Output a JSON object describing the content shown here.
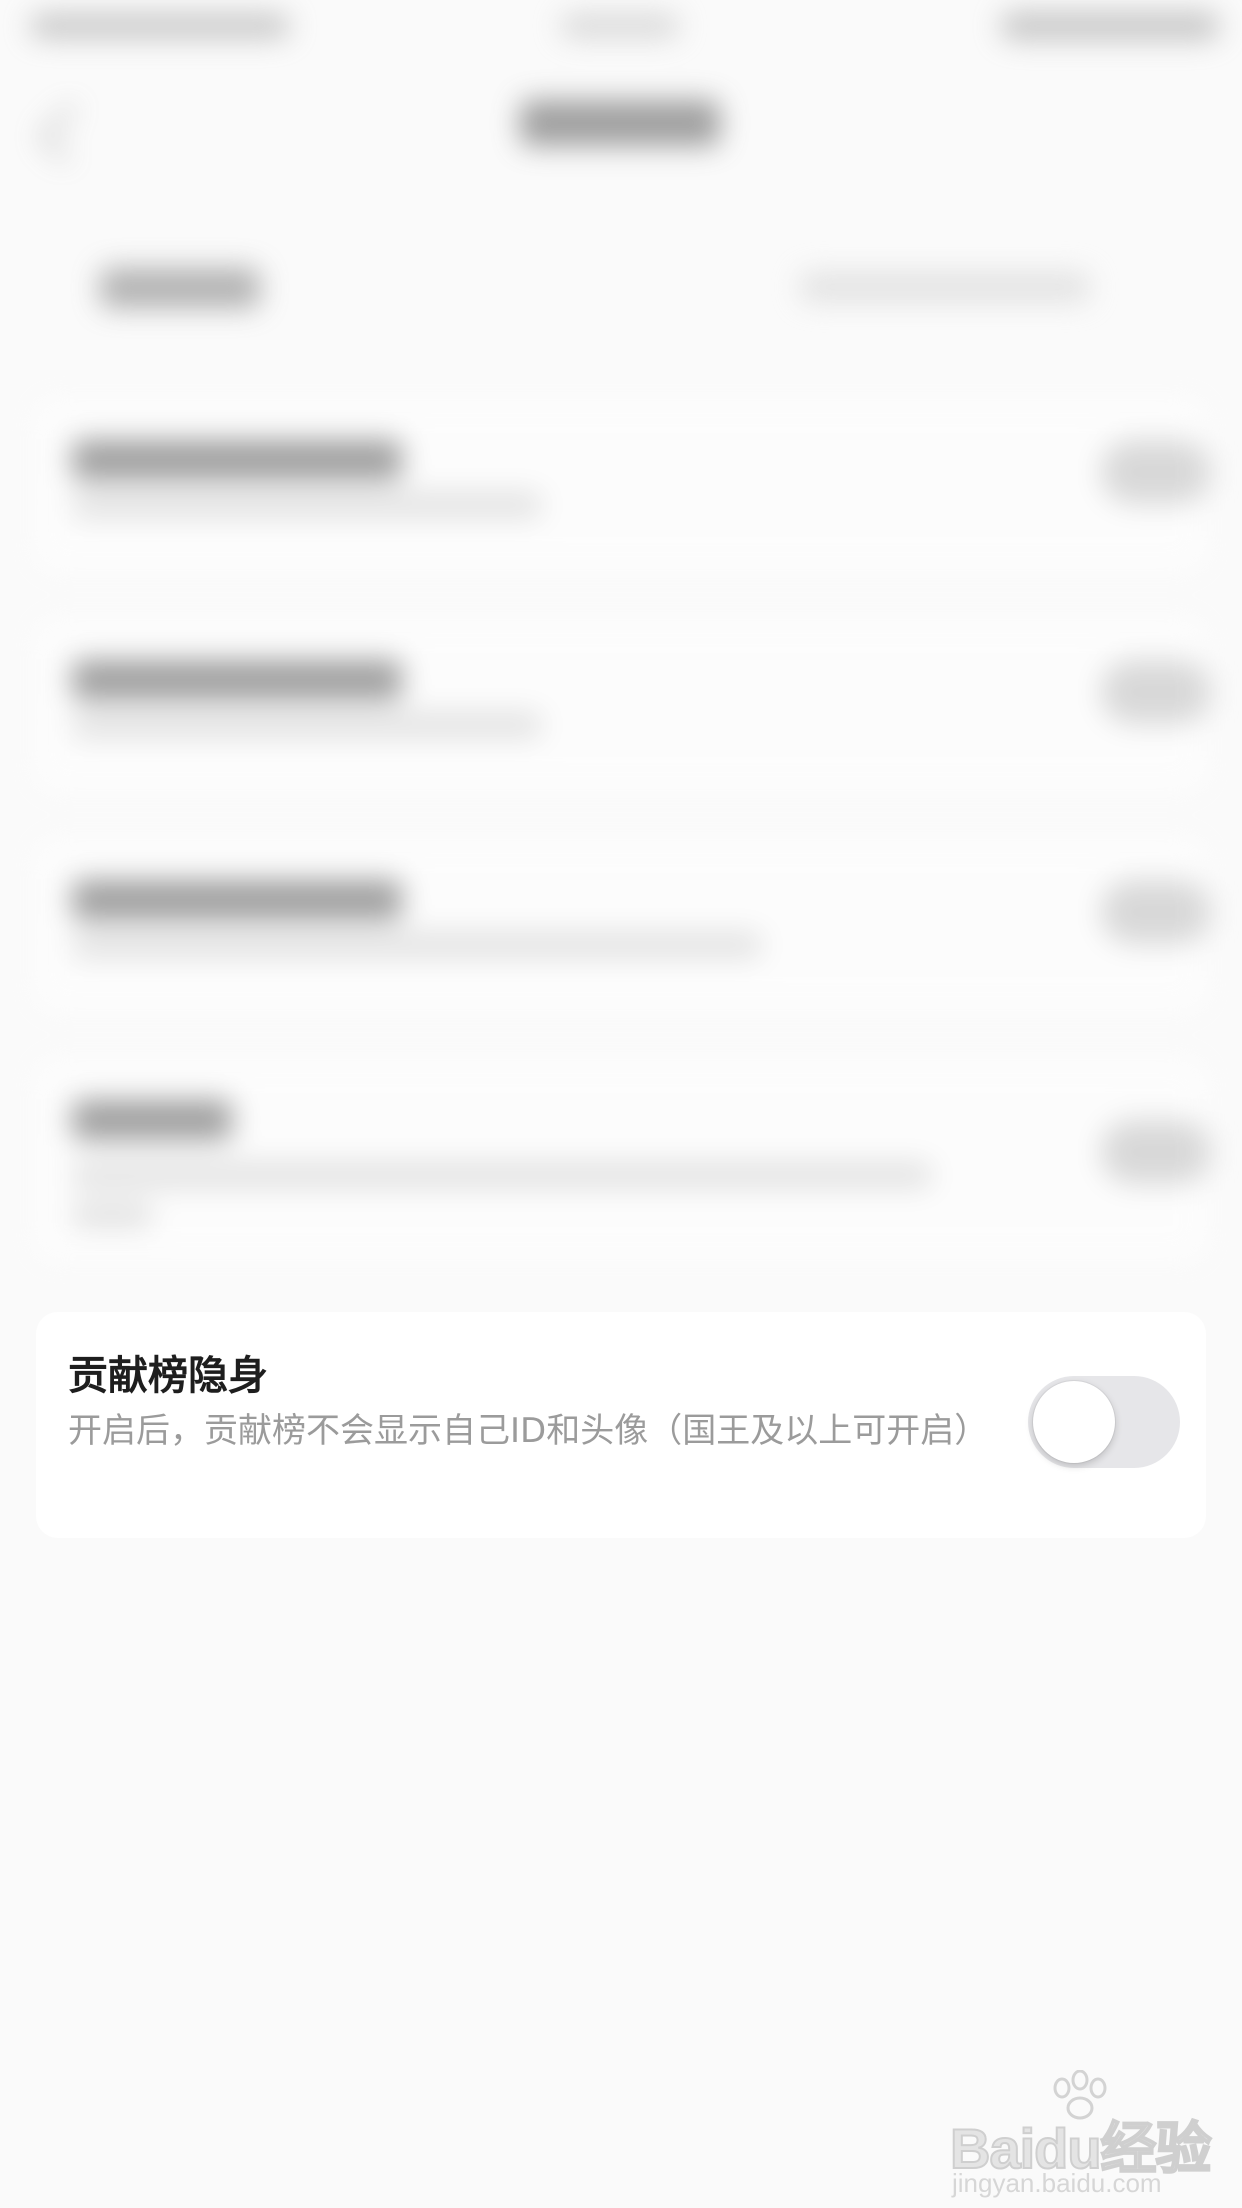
{
  "setting": {
    "title": "贡献榜隐身",
    "description": "开启后，贡献榜不会显示自己ID和头像（国王及以上可开启）",
    "toggle_on": false
  },
  "watermark": {
    "brand": "Baidu经验",
    "url": "jingyan.baidu.com"
  },
  "colors": {
    "toggle_track_off": "#e6e6e9",
    "title_text": "#1e1e1e",
    "description_text": "#9b9b9b",
    "page_background": "#fafafa"
  },
  "icons": {
    "watermark_logo": "paw-icon"
  }
}
